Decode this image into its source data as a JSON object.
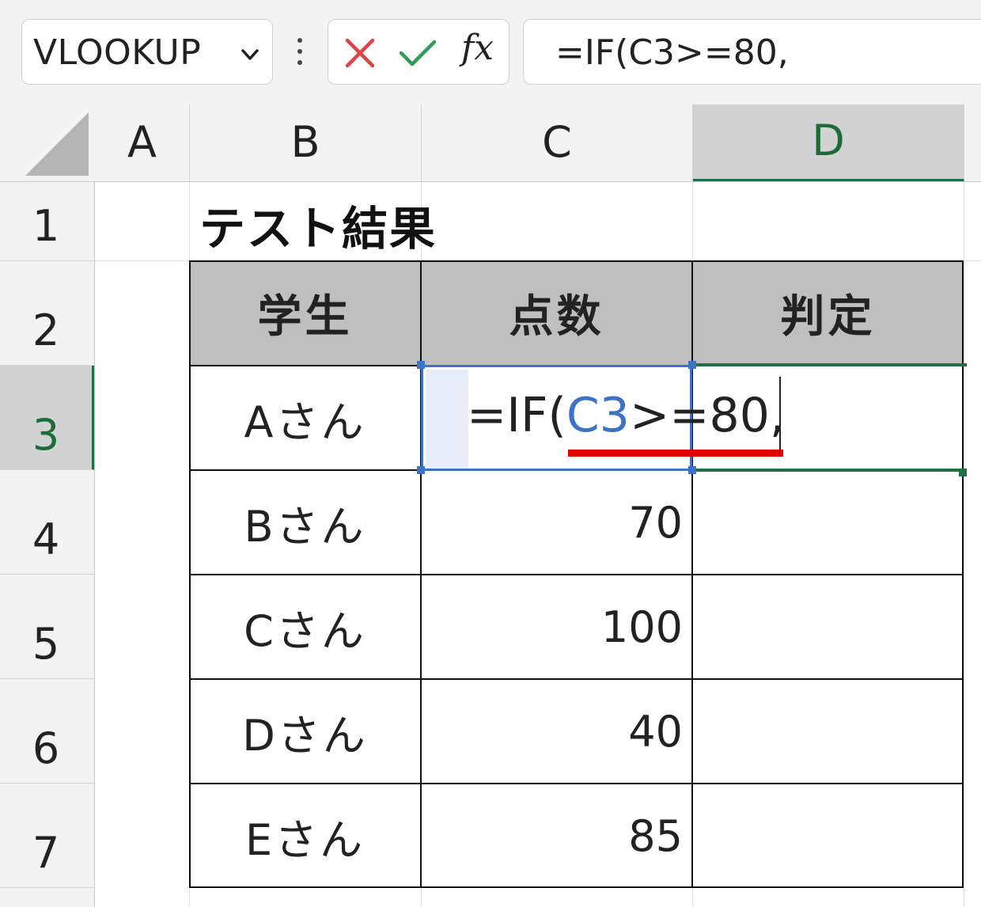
{
  "name_box": {
    "value": "VLOOKUP"
  },
  "formula_bar": {
    "text": "=IF(C3>=80,"
  },
  "columns": [
    "A",
    "B",
    "C",
    "D"
  ],
  "selected_column": "D",
  "rows": [
    "1",
    "2",
    "3",
    "4",
    "5",
    "6",
    "7"
  ],
  "selected_row": "3",
  "sheet": {
    "title": "テスト結果",
    "headers": [
      "学生",
      "点数",
      "判定"
    ],
    "records": [
      {
        "student": "Aさん",
        "score": "",
        "result": ""
      },
      {
        "student": "Bさん",
        "score": "70",
        "result": ""
      },
      {
        "student": "Cさん",
        "score": "100",
        "result": ""
      },
      {
        "student": "Dさん",
        "score": "40",
        "result": ""
      },
      {
        "student": "Eさん",
        "score": "85",
        "result": ""
      }
    ]
  },
  "edit_cell": {
    "prefix": "=IF(",
    "reference": "C3",
    "suffix": ">=80,"
  },
  "colors": {
    "reference_blue": "#3c73c7",
    "selection_green": "#1e7145",
    "annotation_red": "#e00000",
    "header_fill": "#bfbfbf"
  },
  "icons": [
    "chevron-down-icon",
    "more-vertical-icon",
    "cancel-x-icon",
    "enter-check-icon",
    "insert-function-icon"
  ]
}
